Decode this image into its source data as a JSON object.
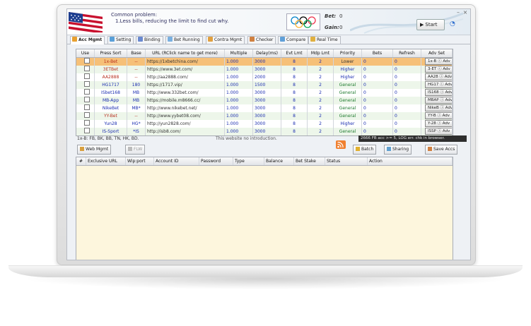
{
  "header": {
    "notice_title": "Common problem:",
    "notice_line": "1.Less bills, reducing the limit to find cut why.",
    "bet_label": "Bet:",
    "bet_value": "0",
    "gain_label": "Gain:",
    "gain_value": "0",
    "start_label": "Start",
    "minimize": "–",
    "close": "×"
  },
  "tabs": [
    {
      "label": "Acc Mgmt",
      "color": "#e8a030"
    },
    {
      "label": "Setting",
      "color": "#5aa0d8"
    },
    {
      "label": "Binding",
      "color": "#6a8ad0"
    },
    {
      "label": "Bet Running",
      "color": "#7ab0e0"
    },
    {
      "label": "Contra Mgmt",
      "color": "#e0a040"
    },
    {
      "label": "Checker",
      "color": "#d08040"
    },
    {
      "label": "Compare",
      "color": "#60a0d8"
    },
    {
      "label": "Real Time",
      "color": "#e0b040"
    }
  ],
  "accounts": {
    "columns": [
      "Use",
      "Press Sort",
      "Base",
      "URL (RClick name to get more)",
      "Multiple",
      "Delay(ms)",
      "Evt Lmt",
      "Mdp Lmt",
      "Priority",
      "Bets",
      "Refresh",
      "Adv Set"
    ],
    "rows": [
      {
        "sort": "1x-Bet",
        "base": "--",
        "url": "https://1xbetchina.com/",
        "multiple": "1.000",
        "delay": "3000",
        "evt": "8",
        "mdp": "2",
        "priority": "Lower",
        "bets": "0",
        "refresh": "0",
        "adv": "1x-B",
        "sel": true
      },
      {
        "sort": "3ETBet",
        "base": "--",
        "url": "https://www.3et.com/",
        "multiple": "1.000",
        "delay": "3000",
        "evt": "8",
        "mdp": "2",
        "priority": "Higher",
        "bets": "0",
        "refresh": "0",
        "adv": "3-ET"
      },
      {
        "sort": "AA2888",
        "base": "--",
        "url": "http://aa2888.com/",
        "multiple": "1.000",
        "delay": "2000",
        "evt": "8",
        "mdp": "2",
        "priority": "Higher",
        "bets": "0",
        "refresh": "0",
        "adv": "AA28"
      },
      {
        "sort": "HG1717",
        "base": "180",
        "url": "https://1717.vip/",
        "multiple": "1.000",
        "delay": "1500",
        "evt": "8",
        "mdp": "2",
        "priority": "General",
        "bets": "0",
        "refresh": "0",
        "adv": "HG17"
      },
      {
        "sort": "ISbet168",
        "base": "MB",
        "url": "http://www.332bet.com/",
        "multiple": "1.000",
        "delay": "3000",
        "evt": "8",
        "mdp": "2",
        "priority": "General",
        "bets": "0",
        "refresh": "0",
        "adv": "IS168"
      },
      {
        "sort": "MB-App",
        "base": "MB",
        "url": "https://mobile.m8666.cc/",
        "multiple": "1.000",
        "delay": "3000",
        "evt": "8",
        "mdp": "2",
        "priority": "General",
        "bets": "0",
        "refresh": "0",
        "adv": "MBAP"
      },
      {
        "sort": "NikeBet",
        "base": "MB*",
        "url": "http://www.nikebet.net/",
        "multiple": "1.000",
        "delay": "3000",
        "evt": "8",
        "mdp": "2",
        "priority": "General",
        "bets": "0",
        "refresh": "0",
        "adv": "NikeB"
      },
      {
        "sort": "YY-Bet",
        "base": "--",
        "url": "http://www.yybet08.com/",
        "multiple": "1.000",
        "delay": "3000",
        "evt": "8",
        "mdp": "2",
        "priority": "General",
        "bets": "0",
        "refresh": "0",
        "adv": "YY-B"
      },
      {
        "sort": "Yun28",
        "base": "HG*",
        "url": "http://yun2828.com/",
        "multiple": "1.000",
        "delay": "3000",
        "evt": "8",
        "mdp": "2",
        "priority": "Higher",
        "bets": "0",
        "refresh": "0",
        "adv": "Y-28"
      },
      {
        "sort": "IS-Sport",
        "base": "*IS",
        "url": "http://isb8.com/",
        "multiple": "1.000",
        "delay": "3000",
        "evt": "8",
        "mdp": "2",
        "priority": "General",
        "bets": "0",
        "refresh": "0",
        "adv": "ISSP"
      }
    ],
    "adv_suffix": "Adv"
  },
  "status": {
    "lang_line": "1x-B: FB, BK, BB, TN, HK, BD.",
    "intro_line": "This website no introduction.",
    "log_text": "2666 FB acc >= 5, LOG err. chk in browser."
  },
  "buttons": {
    "web_mgmt": "Web Mgmt",
    "flw": "FLW",
    "batch": "Batch",
    "sharing": "Sharing",
    "save_accs": "Save Accs"
  },
  "details": {
    "columns": [
      "#",
      "Exclusive URL",
      "Wip:port",
      "Account ID",
      "Password",
      "Type",
      "Balance",
      "Bet Stake",
      "Status",
      "Action"
    ]
  }
}
